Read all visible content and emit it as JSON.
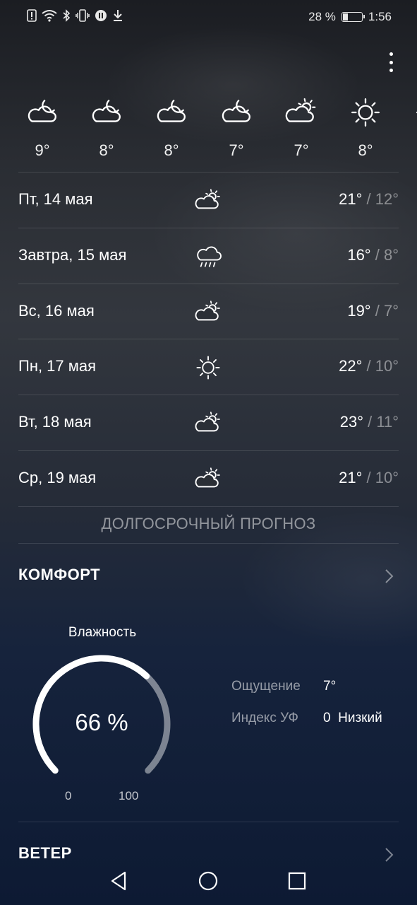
{
  "status_bar": {
    "battery_percent": "28 %",
    "battery_level": 0.28,
    "time": "1:56"
  },
  "hourly": [
    {
      "icon": "night-partly-cloudy-icon",
      "temp": "9°"
    },
    {
      "icon": "night-partly-cloudy-icon",
      "temp": "8°"
    },
    {
      "icon": "night-partly-cloudy-icon",
      "temp": "8°"
    },
    {
      "icon": "night-partly-cloudy-icon",
      "temp": "7°"
    },
    {
      "icon": "partly-sunny-icon",
      "temp": "7°"
    },
    {
      "icon": "sun-icon",
      "temp": "8°"
    }
  ],
  "daily": [
    {
      "day": "Пт, 14 мая",
      "icon": "partly-sunny-icon",
      "high": "21°",
      "low": "12°"
    },
    {
      "day": "Завтра, 15 мая",
      "icon": "rain-icon",
      "high": "16°",
      "low": "8°"
    },
    {
      "day": "Вс, 16 мая",
      "icon": "partly-sunny-icon",
      "high": "19°",
      "low": "7°"
    },
    {
      "day": "Пн, 17 мая",
      "icon": "sun-icon",
      "high": "22°",
      "low": "10°"
    },
    {
      "day": "Вт, 18 мая",
      "icon": "partly-sunny-icon",
      "high": "23°",
      "low": "11°"
    },
    {
      "day": "Ср, 19 мая",
      "icon": "partly-sunny-icon",
      "high": "21°",
      "low": "10°"
    }
  ],
  "long_forecast_label": "ДОЛГОСРОЧНЫЙ ПРОГНОЗ",
  "comfort": {
    "title": "КОМФОРТ",
    "humidity_label": "Влажность",
    "humidity_value": "66 %",
    "humidity_level": 0.66,
    "gauge_min": "0",
    "gauge_max": "100",
    "feels_like_label": "Ощущение",
    "feels_like_value": "7°",
    "uv_label": "Индекс УФ",
    "uv_value": "0",
    "uv_level": "Низкий"
  },
  "wind": {
    "title": "ВЕТЕР"
  }
}
